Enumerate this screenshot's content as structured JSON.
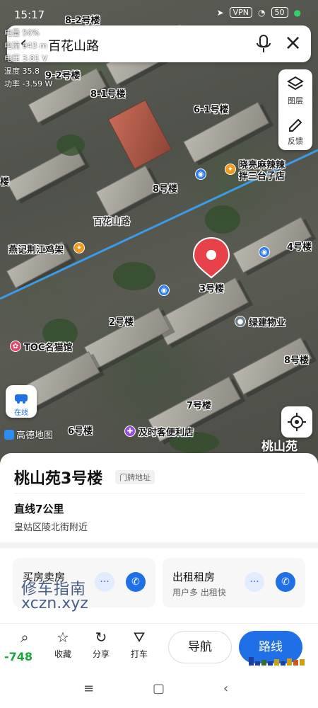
{
  "status_bar": {
    "time": "15:17",
    "vpn": "VPN",
    "battery": "50"
  },
  "debug_overlay": [
    "电量  50%",
    "电流  943 m",
    "电压  3.81 V",
    "温度  35.8",
    "功率  -3.59 W"
  ],
  "search": {
    "query": "百花山路"
  },
  "tools": {
    "layers_label": "图层",
    "feedback_label": "反馈"
  },
  "map_labels": {
    "b82": "8-2号楼",
    "b92": "9-2号楼",
    "b81": "8-1号楼",
    "b61": "6-1号楼",
    "shop": "晓亮麻辣辣",
    "shop2": "拌三台子店",
    "b8": "8号楼",
    "lou": "楼",
    "road": "百花山路",
    "rest": "燕记荆江鸡架",
    "b4": "4号楼",
    "b3": "3号楼",
    "b2": "2号楼",
    "prop": "绿建物业",
    "cafe": "TOC名猫馆",
    "b8b": "8号楼",
    "b7": "7号楼",
    "b6": "6号楼",
    "store": "及时客便利店"
  },
  "online_label": "在线",
  "brand": "高德地图",
  "corner_label": "桃山苑",
  "place": {
    "title": "桃山苑3号楼",
    "tag": "门牌地址",
    "distance": "直线7公里",
    "district": "皇姑区陵北街附近"
  },
  "cards": [
    {
      "title": "买房卖房"
    },
    {
      "title": "出租租房",
      "subtitle": "用户多 出租快"
    }
  ],
  "watermark": {
    "line1": "修车指南",
    "line2": "xczn.xyz"
  },
  "actions": {
    "search": "",
    "fav": "收藏",
    "share": "分享",
    "taxi": "打车"
  },
  "nav_button": "导航",
  "route_button": "路线",
  "overlay_number": "-748",
  "colors": {
    "accent": "#1f6fe6",
    "pin": "#e8414a",
    "road_line": "#3a9be8"
  }
}
